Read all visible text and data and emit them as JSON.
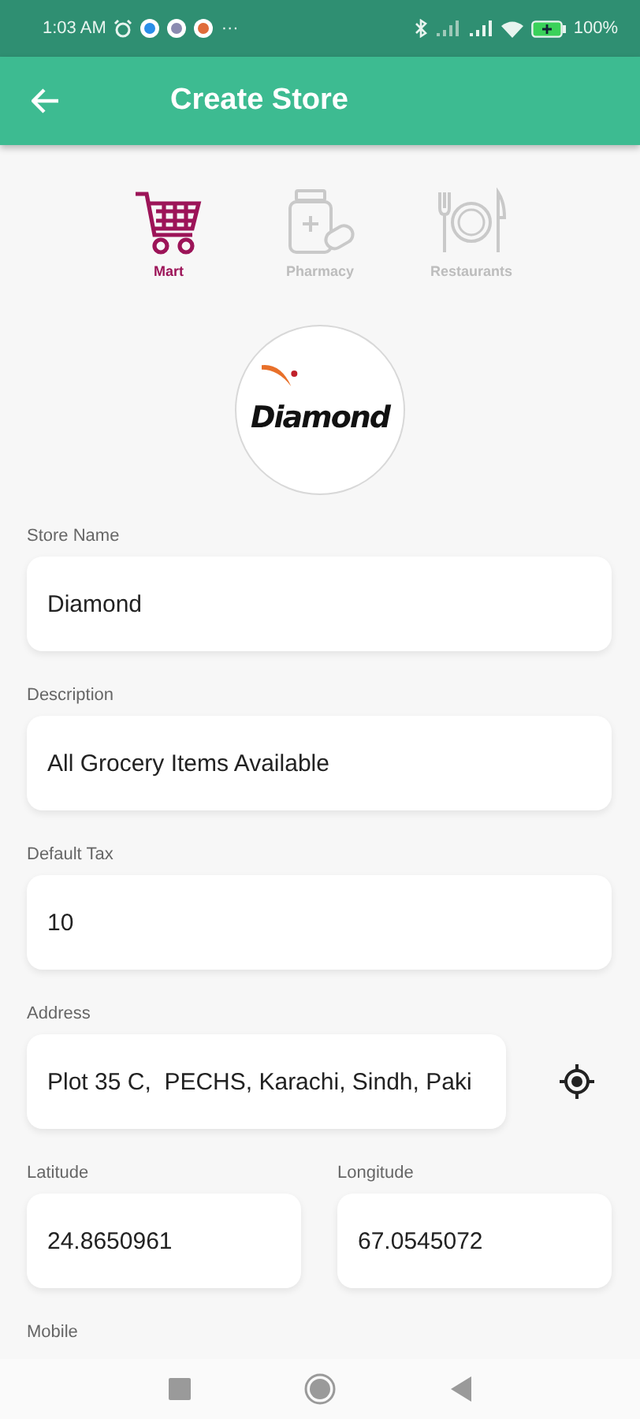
{
  "status_bar": {
    "time": "1:03 AM",
    "more": "···",
    "battery": "100%"
  },
  "app_bar": {
    "title": "Create Store"
  },
  "categories": [
    {
      "label": "Mart",
      "kind": "cart",
      "selected": true
    },
    {
      "label": "Pharmacy",
      "kind": "pharmacy",
      "selected": false
    },
    {
      "label": "Restaurants",
      "kind": "restaurant",
      "selected": false
    }
  ],
  "logo": {
    "text": "Diamond"
  },
  "fields": [
    {
      "label": "Store Name",
      "value": "Diamond"
    },
    {
      "label": "Description",
      "value": "All Grocery Items Available"
    },
    {
      "label": "Default Tax",
      "value": "10"
    },
    {
      "label": "Address",
      "value": "Plot 35 C,  PECHS, Karachi, Sindh, Paki",
      "kind": "location"
    }
  ],
  "coordinates": [
    {
      "label": "Latitude",
      "value": "24.8650961"
    },
    {
      "label": "Longitude",
      "value": "67.0545072"
    }
  ],
  "next_label": "Mobile"
}
